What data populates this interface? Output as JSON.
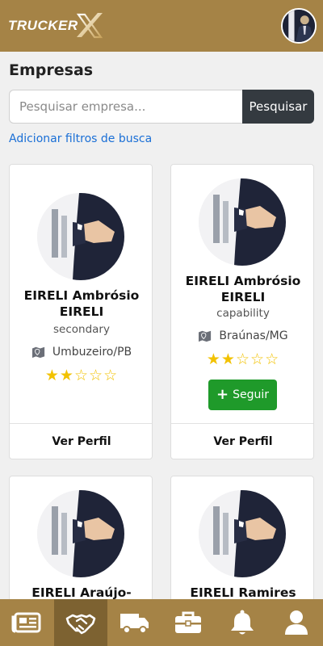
{
  "header": {
    "logo_text": "TRUCKER",
    "logo_icon": "x-logo-icon",
    "avatar_icon": "user-photo"
  },
  "page": {
    "title": "Empresas"
  },
  "search": {
    "placeholder": "Pesquisar empresa...",
    "button_label": "Pesquisar"
  },
  "filters_link": "Adicionar filtros de busca",
  "companies": [
    {
      "name": "EIRELI Ambrósio EIRELI",
      "subtitle": "secondary",
      "location": "Umbuzeiro/PB",
      "rating": 2,
      "max_rating": 5,
      "action": "Ver Perfil"
    },
    {
      "name": "EIRELI Ambrósio EIRELI",
      "subtitle": "capability",
      "location": "Braúnas/MG",
      "rating": 2,
      "max_rating": 5,
      "follow_label": "Seguir",
      "action": "Ver Perfil"
    },
    {
      "name": "EIRELI Araújo-"
    },
    {
      "name": "EIRELI Ramires"
    }
  ],
  "bottom_nav": [
    {
      "icon": "newspaper-icon",
      "active": false
    },
    {
      "icon": "handshake-icon",
      "active": true
    },
    {
      "icon": "truck-icon",
      "active": false
    },
    {
      "icon": "briefcase-icon",
      "active": false
    },
    {
      "icon": "bell-icon",
      "active": false
    },
    {
      "icon": "user-icon",
      "active": false
    }
  ],
  "colors": {
    "brand": "#a58346",
    "brand_active": "#7d6231",
    "link": "#1a6fd6",
    "follow": "#1f9a2a",
    "star": "#f2c200",
    "search_button": "#343a40"
  }
}
